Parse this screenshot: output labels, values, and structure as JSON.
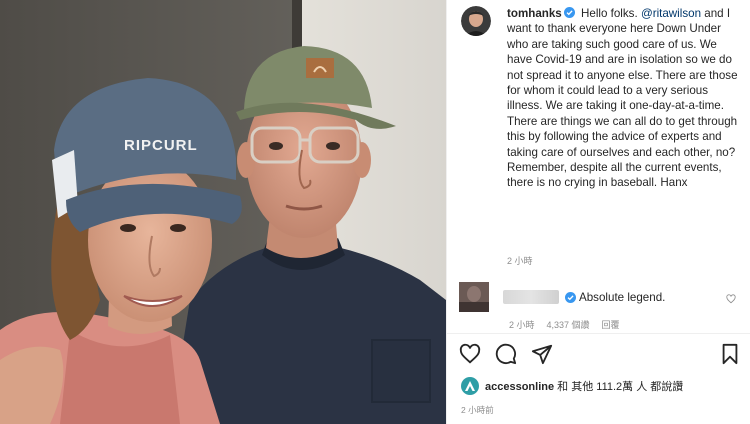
{
  "post": {
    "username": "tomhanks",
    "mention": "@ritawilson",
    "caption_before_mention": "Hello folks.",
    "caption_after_mention": "and I want to thank everyone here Down Under who are taking such good care of us. We have Covid-19 and are in isolation so we do not spread it to anyone else. There are those for whom it could lead to a very serious illness. We are taking it one-day-at-a-time. There are things we can all do to get through this by following the advice of experts and taking care of ourselves and each other, no? Remember, despite all the current events, there is no crying in baseball. Hanx",
    "caption_time": "2 小時",
    "photo_cap_text": "RIPCURL"
  },
  "comment": {
    "text": "Absolute legend.",
    "time": "2 小時",
    "likes": "4,337 個讚",
    "reply": "回覆"
  },
  "likes": {
    "user": "accessonline",
    "rest": " 和 其他 111.2萬 人 都說讚"
  },
  "post_time": "2 小時前",
  "colors": {
    "verified": "#3897f0",
    "mention": "#00376b",
    "meta_gray": "#8e8e8e"
  },
  "icons": [
    "verified-icon",
    "heart-icon",
    "comment-icon",
    "share-icon",
    "save-icon",
    "small-heart-icon"
  ]
}
